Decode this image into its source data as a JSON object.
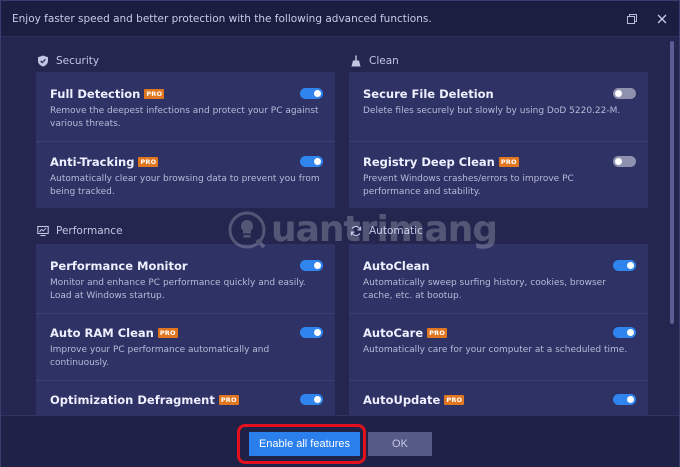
{
  "window": {
    "title": "Enjoy faster speed and better protection with the following advanced functions."
  },
  "sections": {
    "security": {
      "title": "Security",
      "items": [
        {
          "name": "Full Detection",
          "pro": "PRO",
          "desc": "Remove the deepest infections and protect your PC against various threats.",
          "enabled": true
        },
        {
          "name": "Anti-Tracking",
          "pro": "PRO",
          "desc": "Automatically clear your browsing data to prevent you from being tracked.",
          "enabled": true
        }
      ]
    },
    "clean": {
      "title": "Clean",
      "items": [
        {
          "name": "Secure File Deletion",
          "desc": "Delete files securely but slowly by using DoD 5220.22-M.",
          "enabled": false
        },
        {
          "name": "Registry Deep Clean",
          "pro": "PRO",
          "desc": "Prevent Windows crashes/errors to improve PC performance and stability.",
          "enabled": false
        }
      ]
    },
    "performance": {
      "title": "Performance",
      "items": [
        {
          "name": "Performance Monitor",
          "desc": "Monitor and enhance PC performance quickly and easily. Load at Windows startup.",
          "enabled": true
        },
        {
          "name": "Auto RAM Clean",
          "pro": "PRO",
          "desc": "Improve your PC performance automatically and continuously.",
          "enabled": true
        },
        {
          "name": "Optimization Defragment",
          "pro": "PRO",
          "desc": "",
          "enabled": true
        }
      ]
    },
    "automatic": {
      "title": "Automatic",
      "items": [
        {
          "name": "AutoClean",
          "desc": "Automatically sweep surfing history, cookies, browser cache, etc. at bootup.",
          "enabled": true
        },
        {
          "name": "AutoCare",
          "pro": "PRO",
          "desc": "Automatically care for your computer at a scheduled time.",
          "enabled": true
        },
        {
          "name": "AutoUpdate",
          "pro": "PRO",
          "desc": "",
          "enabled": true
        }
      ]
    }
  },
  "footer": {
    "enable_all_label": "Enable all features",
    "ok_label": "OK"
  },
  "watermark": {
    "text": "uantrimang"
  },
  "colors": {
    "accent": "#2f84ee",
    "pro_badge": "#e0761f",
    "highlight_ring": "#e3111d",
    "panel": "#2f3264",
    "background": "#24264f"
  }
}
